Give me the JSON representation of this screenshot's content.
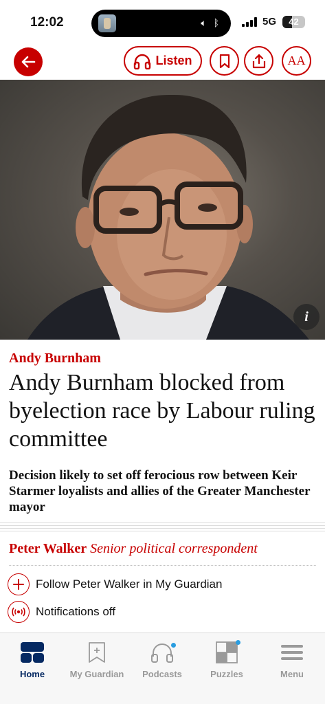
{
  "status_bar": {
    "time": "12:02",
    "network": "5G",
    "battery": "42",
    "battery_level": 0.42
  },
  "toolbar": {
    "listen_label": "Listen",
    "text_size_label": "AA"
  },
  "hero": {
    "info_label": "i"
  },
  "article": {
    "kicker": "Andy Burnham",
    "headline": "Andy Burnham blocked from byelection race by Labour ruling committee",
    "standfirst": "Decision likely to set off ferocious row between Keir Starmer loyalists and allies of the Greater Manchester mayor",
    "byline_name": "Peter Walker",
    "byline_role": "Senior political correspondent",
    "follow_label": "Follow Peter Walker in My Guardian",
    "notifications_label": "Notifications off"
  },
  "tabs": [
    {
      "label": "Home",
      "icon": "home-icon",
      "active": true
    },
    {
      "label": "My Guardian",
      "icon": "bookmark-plus-icon"
    },
    {
      "label": "Podcasts",
      "icon": "headphones-icon"
    },
    {
      "label": "Puzzles",
      "icon": "crossword-icon"
    },
    {
      "label": "Menu",
      "icon": "menu-icon"
    }
  ],
  "colors": {
    "accent": "#c70000",
    "brand_navy": "#052962",
    "badge_blue": "#2a9de0"
  }
}
